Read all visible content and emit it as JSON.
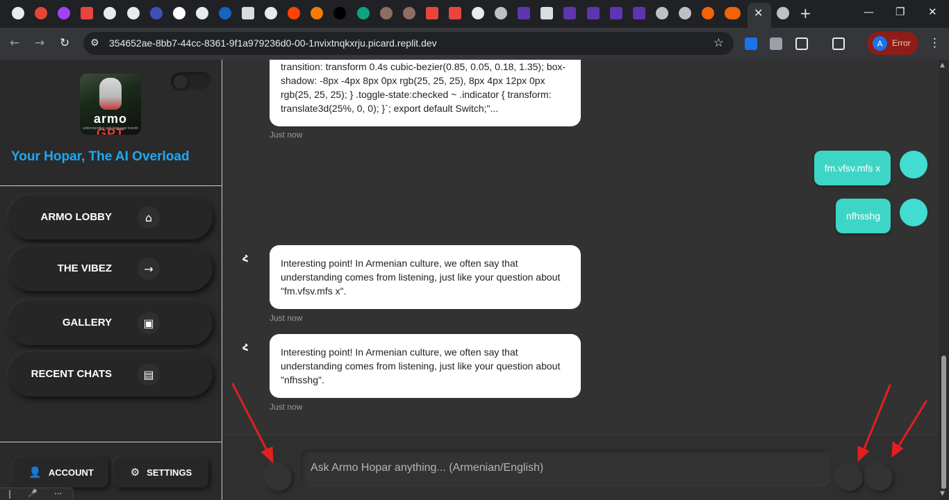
{
  "browser": {
    "tabs_icons": [
      "openai-icon",
      "gmail-icon",
      "podcast-icon",
      "nine-icon",
      "openai-icon",
      "openai-icon",
      "circle-icon",
      "google-icon",
      "github-icon",
      "paypal-icon",
      "doc-icon",
      "openai-icon",
      "reddit-icon",
      "play-icon",
      "vercel-icon",
      "spiral-icon",
      "avatar-icon",
      "avatar-icon",
      "nine-icon",
      "nine-icon",
      "pause-icon",
      "chrome-icon",
      "ui-icon",
      "doc-icon",
      "ui-icon",
      "ui-icon",
      "ui-icon",
      "ui-icon",
      "chrome-icon",
      "globe-icon",
      "replit-icon",
      "replit-icon",
      "replit-icon",
      "globe-icon"
    ],
    "active_tab_close": "✕",
    "new_tab": "+",
    "window_controls": {
      "minimize": "—",
      "maximize": "❐",
      "close": "✕"
    },
    "url": "354652ae-8bb7-44cc-8361-9f1a979236d0-00-1nvixtnqkxrju.picard.replit.dev",
    "profile": {
      "initial": "A",
      "label": "Error"
    }
  },
  "sidebar": {
    "logo": {
      "word1": "armo",
      "word2": "GPT",
      "subtitle": "understanding and language transform"
    },
    "tagline": "Your Hopar, The AI Overload",
    "nav": [
      {
        "label": "ARMO LOBBY",
        "icon": "home-icon",
        "glyph": "⌂"
      },
      {
        "label": "THE VIBEZ",
        "icon": "arrow-right-icon",
        "glyph": "→"
      },
      {
        "label": "GALLERY",
        "icon": "image-icon",
        "glyph": "▣"
      },
      {
        "label": "RECENT CHATS",
        "icon": "chat-icon",
        "glyph": "▤"
      }
    ],
    "account_label": "ACCOUNT",
    "settings_label": "SETTINGS",
    "voice_bar": {
      "left": "|",
      "mic": "🎤",
      "more": "···"
    }
  },
  "chat": {
    "messages": [
      {
        "role": "ai",
        "text": "transition: transform 0.4s cubic-bezier(0.85, 0.05, 0.18, 1.35); box-shadow: -8px -4px 8px 0px rgb(25, 25, 25), 8px 4px 12px 0px rgb(25, 25, 25); } .toggle-state:checked ~ .indicator { transform: translate3d(25%, 0, 0); }`; export default Switch;\"...",
        "time": "Just now"
      },
      {
        "role": "user",
        "text": "fm.vfsv.mfs x"
      },
      {
        "role": "user",
        "text": "nfhsshg"
      },
      {
        "role": "ai",
        "text": "Interesting point! In Armenian culture, we often say that understanding comes from listening, just like your question about \"fm.vfsv.mfs x\".",
        "time": "Just now"
      },
      {
        "role": "ai",
        "text": "Interesting point! In Armenian culture, we often say that understanding comes from listening, just like your question about \"nfhsshg\".",
        "time": "Just now"
      }
    ],
    "ai_avatar_glyph": "Հ",
    "input_placeholder": "Ask Armo Hopar anything... (Armenian/English)"
  },
  "colors": {
    "accent_teal": "#3dd6c6",
    "tagline_blue": "#1fa9f2",
    "annotation_red": "#e02020"
  }
}
